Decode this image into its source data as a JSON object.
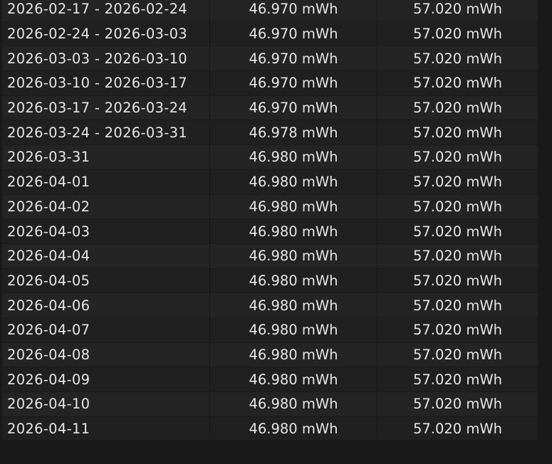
{
  "table": {
    "rows": [
      {
        "period": "2026-02-17 - 2026-02-24",
        "full_charge": "46.970 mWh",
        "design_capacity": "57.020 mWh"
      },
      {
        "period": "2026-02-24 - 2026-03-03",
        "full_charge": "46.970 mWh",
        "design_capacity": "57.020 mWh"
      },
      {
        "period": "2026-03-03 - 2026-03-10",
        "full_charge": "46.970 mWh",
        "design_capacity": "57.020 mWh"
      },
      {
        "period": "2026-03-10 - 2026-03-17",
        "full_charge": "46.970 mWh",
        "design_capacity": "57.020 mWh"
      },
      {
        "period": "2026-03-17 - 2026-03-24",
        "full_charge": "46.970 mWh",
        "design_capacity": "57.020 mWh"
      },
      {
        "period": "2026-03-24 - 2026-03-31",
        "full_charge": "46.978 mWh",
        "design_capacity": "57.020 mWh"
      },
      {
        "period": "2026-03-31",
        "full_charge": "46.980 mWh",
        "design_capacity": "57.020 mWh"
      },
      {
        "period": "2026-04-01",
        "full_charge": "46.980 mWh",
        "design_capacity": "57.020 mWh"
      },
      {
        "period": "2026-04-02",
        "full_charge": "46.980 mWh",
        "design_capacity": "57.020 mWh"
      },
      {
        "period": "2026-04-03",
        "full_charge": "46.980 mWh",
        "design_capacity": "57.020 mWh"
      },
      {
        "period": "2026-04-04",
        "full_charge": "46.980 mWh",
        "design_capacity": "57.020 mWh"
      },
      {
        "period": "2026-04-05",
        "full_charge": "46.980 mWh",
        "design_capacity": "57.020 mWh"
      },
      {
        "period": "2026-04-06",
        "full_charge": "46.980 mWh",
        "design_capacity": "57.020 mWh"
      },
      {
        "period": "2026-04-07",
        "full_charge": "46.980 mWh",
        "design_capacity": "57.020 mWh"
      },
      {
        "period": "2026-04-08",
        "full_charge": "46.980 mWh",
        "design_capacity": "57.020 mWh"
      },
      {
        "period": "2026-04-09",
        "full_charge": "46.980 mWh",
        "design_capacity": "57.020 mWh"
      },
      {
        "period": "2026-04-10",
        "full_charge": "46.980 mWh",
        "design_capacity": "57.020 mWh"
      },
      {
        "period": "2026-04-11",
        "full_charge": "46.980 mWh",
        "design_capacity": "57.020 mWh"
      }
    ]
  },
  "colors": {
    "background": "#191919",
    "row_odd": "#242424",
    "row_even": "#202020",
    "text": "#e6e6e6"
  }
}
